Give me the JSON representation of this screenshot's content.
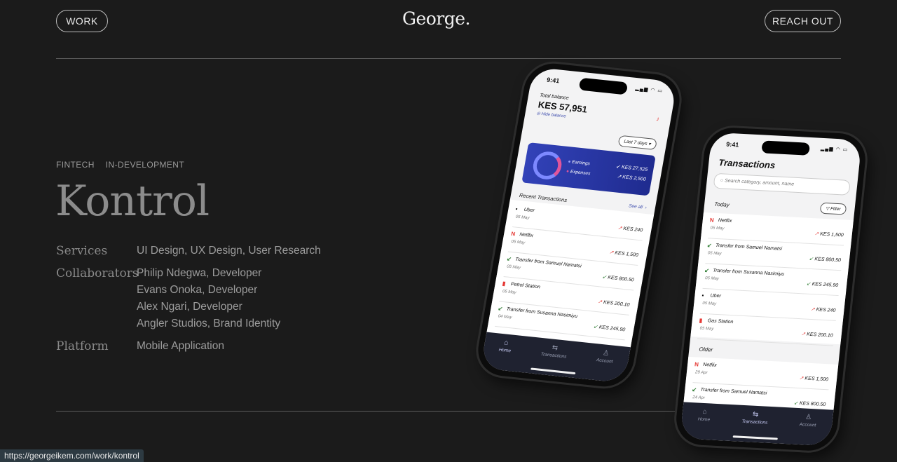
{
  "nav": {
    "work_label": "WORK",
    "logo": "George.",
    "reach_label": "REACH OUT"
  },
  "project": {
    "tags": [
      "FINTECH",
      "IN-DEVELOPMENT"
    ],
    "title": "Kontrol",
    "meta": [
      {
        "key": "Services",
        "values": [
          "UI Design, UX Design, User Research"
        ]
      },
      {
        "key": "Collaborators",
        "values": [
          "Philip Ndegwa, Developer",
          "Evans Onoka, Developer",
          "Alex Ngari, Developer",
          "Angler Studios, Brand Identity"
        ]
      },
      {
        "key": "Platform",
        "values": [
          "Mobile Application"
        ]
      }
    ]
  },
  "phone1": {
    "time": "9:41",
    "balance_label": "Total balance",
    "balance": "KES 57,951",
    "hide_label": "Hide balance",
    "range": "Last 7 days",
    "earnings_label": "Earnings",
    "earnings": "KES 27,525",
    "expenses_label": "Expenses",
    "expenses": "KES 2,500",
    "recent_label": "Recent Transactions",
    "see_all": "See all",
    "transactions": [
      {
        "brand": "U",
        "name": "Uber",
        "date": "05 May",
        "amount": "KES 240",
        "dir": "out"
      },
      {
        "brand": "N",
        "name": "Netflix",
        "date": "05 May",
        "amount": "KES 1,500",
        "dir": "out"
      },
      {
        "brand": "↙",
        "name": "Transfer from Samuel Namatsi",
        "date": "05 May",
        "amount": "KES 800.50",
        "dir": "in"
      },
      {
        "brand": "P",
        "name": "Petrol Station",
        "date": "05 May",
        "amount": "KES 200.10",
        "dir": "out"
      },
      {
        "brand": "↙",
        "name": "Transfer from Susanna Nasimiyu",
        "date": "04 May",
        "amount": "KES 245.90",
        "dir": "in"
      }
    ],
    "tabs": [
      "Home",
      "Transactions",
      "Account"
    ]
  },
  "phone2": {
    "time": "9:41",
    "title": "Transactions",
    "search_placeholder": "Search category, amount, name",
    "today_label": "Today",
    "filter_label": "Filter",
    "older_label": "Older",
    "today": [
      {
        "brand": "N",
        "name": "Netflix",
        "date": "05 May",
        "amount": "KES 1,500",
        "dir": "out"
      },
      {
        "brand": "↙",
        "name": "Transfer from Samuel Namatsi",
        "date": "05 May",
        "amount": "KES 800.50",
        "dir": "in"
      },
      {
        "brand": "↙",
        "name": "Transfer from Susanna Nasimiyu",
        "date": "05 May",
        "amount": "KES 245.90",
        "dir": "in"
      },
      {
        "brand": "U",
        "name": "Uber",
        "date": "05 May",
        "amount": "KES 240",
        "dir": "out"
      },
      {
        "brand": "G",
        "name": "Gas Station",
        "date": "05 May",
        "amount": "KES 200.10",
        "dir": "out"
      }
    ],
    "older": [
      {
        "brand": "N",
        "name": "Netflix",
        "date": "29 Apr",
        "amount": "KES 1,500",
        "dir": "out"
      },
      {
        "brand": "↙",
        "name": "Transfer from Samuel Namatsi",
        "date": "24 Apr",
        "amount": "KES 800.50",
        "dir": "in"
      }
    ],
    "tabs": [
      "Home",
      "Transactions",
      "Account"
    ]
  },
  "status_url": "https://georgeikem.com/work/kontrol",
  "colors": {
    "background": "#1b1b1b",
    "card": "#2b3a9e",
    "expense": "#e53935",
    "income": "#2e7d32"
  }
}
